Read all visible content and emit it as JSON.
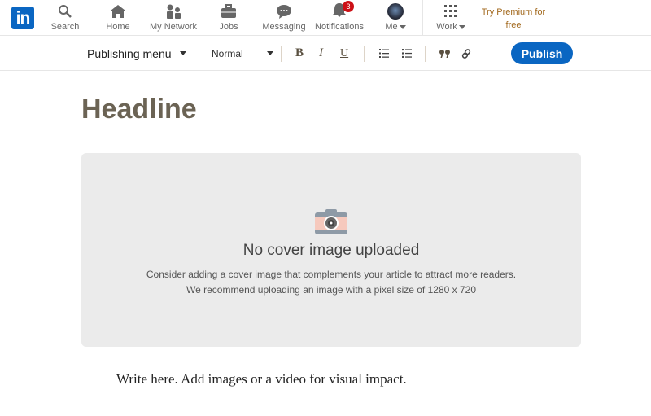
{
  "nav": {
    "logo": "in",
    "items": [
      {
        "label": "Search",
        "icon": "search-icon"
      },
      {
        "label": "Home",
        "icon": "home-icon"
      },
      {
        "label": "My Network",
        "icon": "network-icon"
      },
      {
        "label": "Jobs",
        "icon": "briefcase-icon"
      },
      {
        "label": "Messaging",
        "icon": "message-icon"
      },
      {
        "label": "Notifications",
        "icon": "bell-icon",
        "badge": "3"
      },
      {
        "label": "Me",
        "icon": "avatar"
      },
      {
        "label": "Work",
        "icon": "grid-icon"
      }
    ],
    "premium": "Try Premium for free"
  },
  "toolbar": {
    "publishing_menu": "Publishing menu",
    "style": "Normal",
    "bold": "B",
    "italic": "I",
    "underline": "U",
    "publish": "Publish"
  },
  "editor": {
    "headline": "Headline",
    "cover_title": "No cover image uploaded",
    "cover_line1": "Consider adding a cover image that complements your article to attract more readers.",
    "cover_line2": "We recommend uploading an image with a pixel size of 1280 x 720",
    "body_placeholder": "Write here. Add images or a video for visual impact."
  },
  "colors": {
    "brand": "#0a66c2",
    "premium": "#a36a1f",
    "badge": "#cc1016"
  }
}
